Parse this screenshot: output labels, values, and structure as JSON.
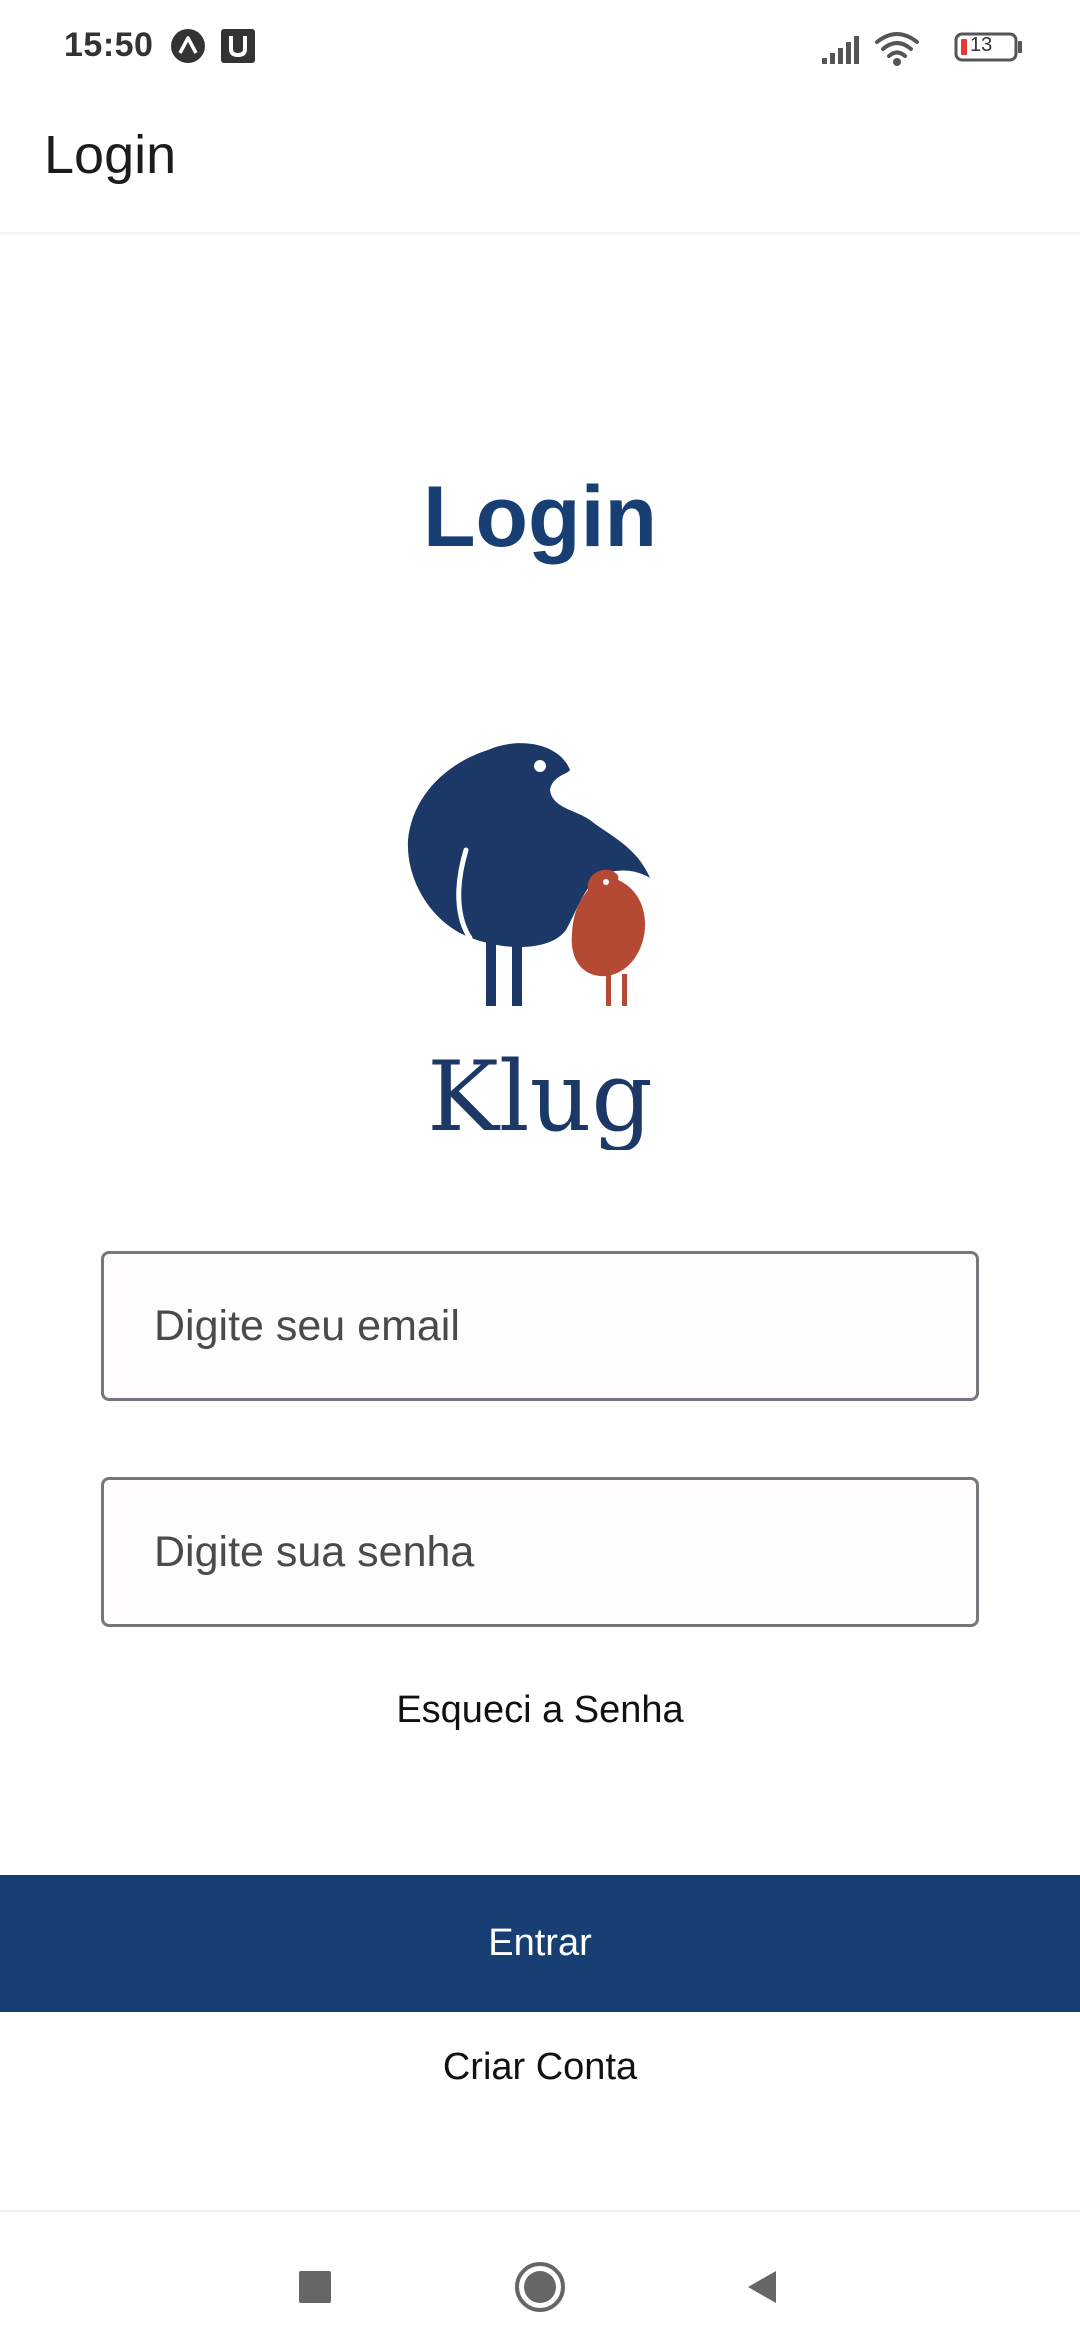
{
  "status_bar": {
    "time": "15:50",
    "notification_icons": [
      "expo-icon",
      "u-app-icon"
    ],
    "battery_level": "13"
  },
  "app_bar": {
    "title": "Login"
  },
  "main": {
    "heading": "Login",
    "logo_text": "Klug",
    "email_placeholder": "Digite seu email",
    "password_placeholder": "Digite sua senha",
    "forgot_password": "Esqueci a Senha",
    "enter_button": "Entrar",
    "create_account": "Criar Conta"
  },
  "nav_bar": {
    "buttons": [
      "recents-icon",
      "home-icon",
      "back-icon"
    ]
  },
  "colors": {
    "primary": "#173f73",
    "logo_navy": "#1c3866",
    "logo_red": "#b44a33",
    "input_fill": "#fffbfe",
    "input_border": "#79747e"
  }
}
